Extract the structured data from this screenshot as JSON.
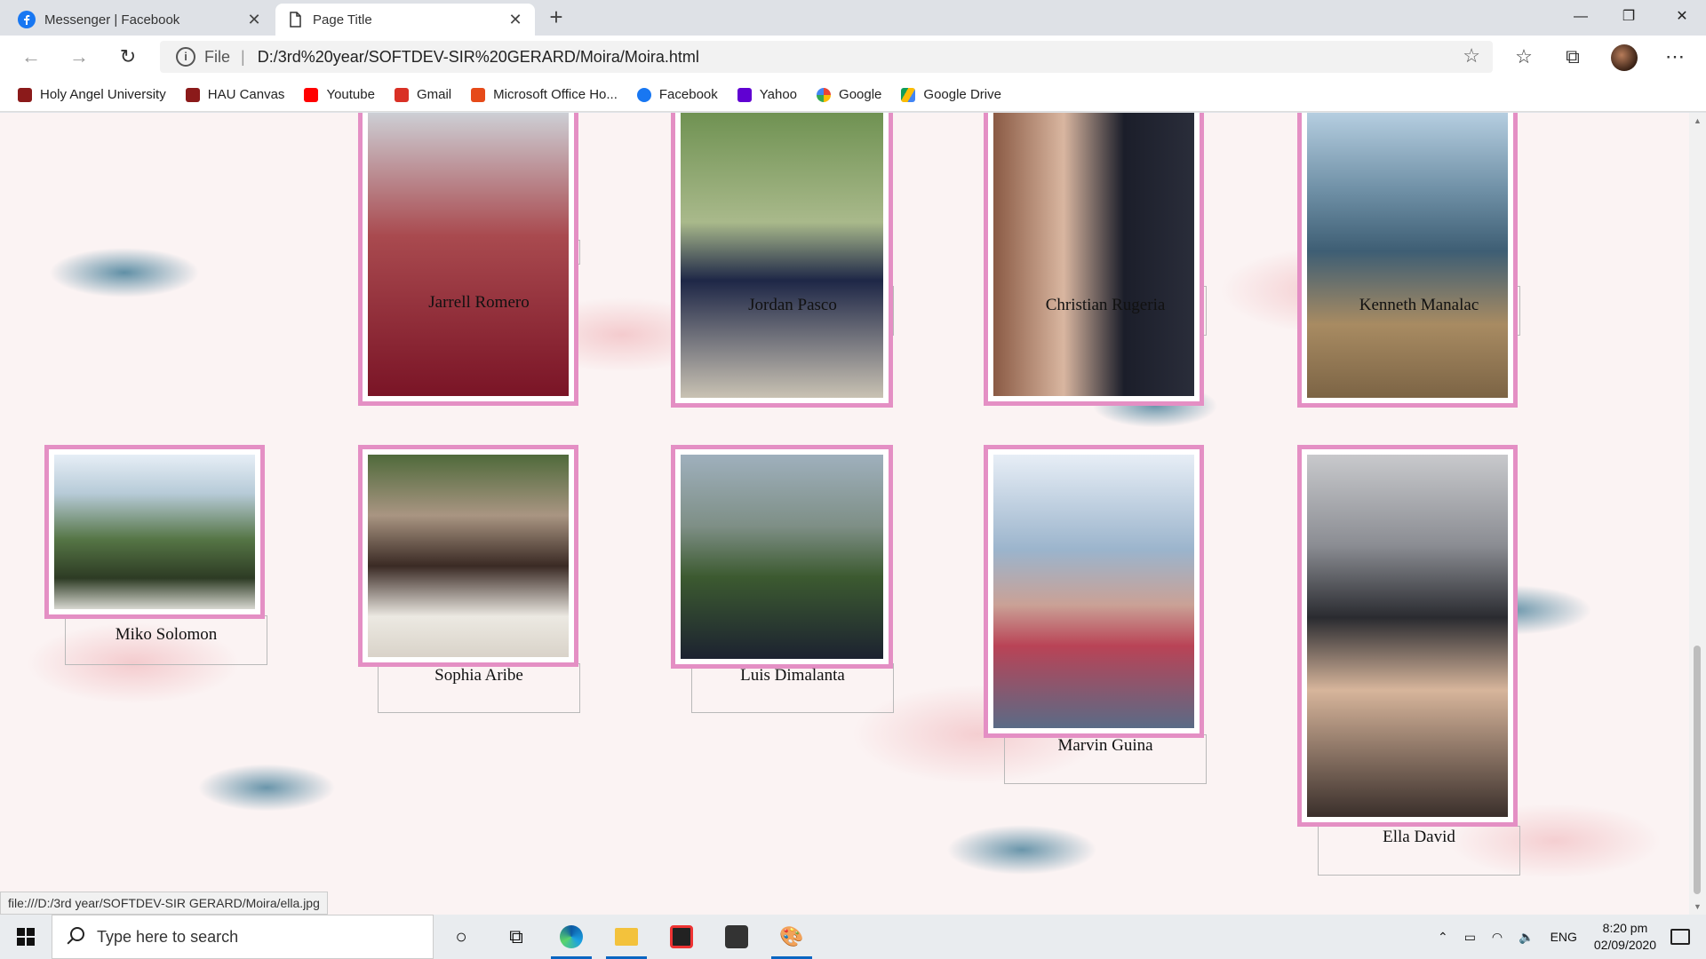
{
  "browser": {
    "tabs": [
      {
        "title": "Messenger | Facebook",
        "favicon": "facebook-icon",
        "color": "#1877f2"
      },
      {
        "title": "Page Title",
        "favicon": "page-icon"
      }
    ],
    "address": {
      "scheme": "File",
      "url": "D:/3rd%20year/SOFTDEV-SIR%20GERARD/Moira/Moira.html"
    },
    "bookmarks": [
      {
        "label": "Holy Angel University",
        "color": "#8b1a1a"
      },
      {
        "label": "HAU Canvas",
        "color": "#8b1a1a"
      },
      {
        "label": "Youtube",
        "color": "#ff0000"
      },
      {
        "label": "Gmail",
        "color": "#d93025"
      },
      {
        "label": "Microsoft Office Ho...",
        "color": "#e64a19"
      },
      {
        "label": "Facebook",
        "color": "#1877f2"
      },
      {
        "label": "Yahoo",
        "color": "#6001d2"
      },
      {
        "label": "Google",
        "color": "#4285f4"
      },
      {
        "label": "Google Drive",
        "color": "#0f9d58"
      }
    ],
    "status_url": "file:///D:/3rd year/SOFTDEV-SIR GERARD/Moira/ella.jpg"
  },
  "gallery": {
    "frame_color": "#e48fc4",
    "people": [
      {
        "name": "Jarrell Romero"
      },
      {
        "name": "Jordan Pasco"
      },
      {
        "name": "Christian Rugeria"
      },
      {
        "name": "Kenneth Manalac"
      },
      {
        "name": "Miko Solomon"
      },
      {
        "name": "Sophia Aribe"
      },
      {
        "name": "Luis Dimalanta"
      },
      {
        "name": "Marvin Guina"
      },
      {
        "name": "Ella David"
      }
    ]
  },
  "taskbar": {
    "search_placeholder": "Type here to search",
    "language": "ENG",
    "time": "8:20 pm",
    "date": "02/09/2020"
  }
}
